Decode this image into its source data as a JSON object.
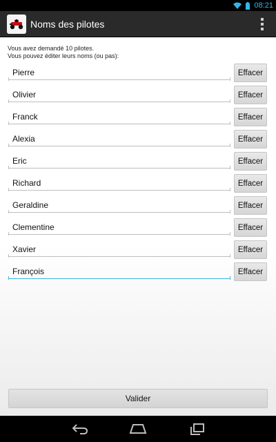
{
  "status_bar": {
    "time": "08:21",
    "icons": [
      "wifi-icon",
      "battery-icon"
    ],
    "accent_color": "#33b5e5"
  },
  "action_bar": {
    "title": "Noms des pilotes",
    "app_icon": "kart-icon",
    "menu_icon": "overflow-menu-icon"
  },
  "intro": {
    "line1": "Vous avez demandé 10 pilotes.",
    "line2": "Vous pouvez éditer leurs noms (ou pas):"
  },
  "pilots": [
    {
      "name": "Pierre",
      "button": "Effacer"
    },
    {
      "name": "Olivier",
      "button": "Effacer"
    },
    {
      "name": "Franck",
      "button": "Effacer"
    },
    {
      "name": "Alexia",
      "button": "Effacer"
    },
    {
      "name": "Eric",
      "button": "Effacer"
    },
    {
      "name": "Richard",
      "button": "Effacer"
    },
    {
      "name": "Geraldine",
      "button": "Effacer"
    },
    {
      "name": "Clementine",
      "button": "Effacer"
    },
    {
      "name": "Xavier",
      "button": "Effacer"
    },
    {
      "name": "François",
      "button": "Effacer",
      "focused": true
    }
  ],
  "footer": {
    "validate_label": "Valider"
  },
  "nav_bar": {
    "icons": [
      "back-icon",
      "home-icon",
      "recents-icon"
    ]
  }
}
